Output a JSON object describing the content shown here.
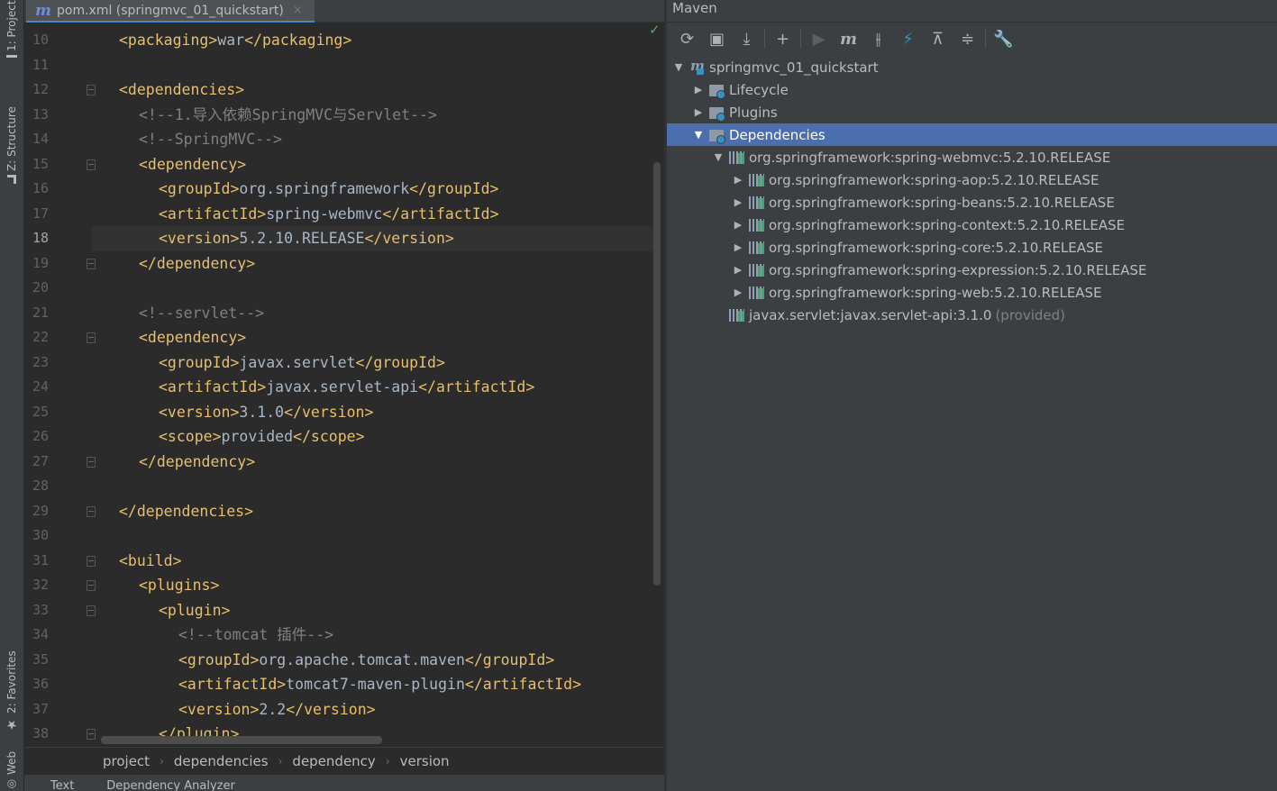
{
  "left_strip": {
    "project_tab": "1: Project",
    "structure_tab": "Z: Structure",
    "favorites_tab": "2: Favorites",
    "web_tab": "Web"
  },
  "editor": {
    "file_tab": {
      "icon": "maven-m-icon",
      "label": "pom.xml (springmvc_01_quickstart)",
      "close": "×"
    },
    "current_line": 18,
    "lines": [
      {
        "num": "10",
        "parts": [
          [
            "tag",
            "<packaging>"
          ],
          [
            "txt",
            "war"
          ],
          [
            "tag",
            "</packaging>"
          ]
        ],
        "indent": 0,
        "fold": false
      },
      {
        "num": "11",
        "parts": [],
        "indent": 0,
        "fold": false
      },
      {
        "num": "12",
        "parts": [
          [
            "tag",
            "<dependencies>"
          ]
        ],
        "indent": 0,
        "fold": true
      },
      {
        "num": "13",
        "parts": [
          [
            "cmt",
            "<!--1.导入依赖SpringMVC与Servlet-->"
          ]
        ],
        "indent": 1,
        "fold": false
      },
      {
        "num": "14",
        "parts": [
          [
            "cmt",
            "<!--SpringMVC-->"
          ]
        ],
        "indent": 1,
        "fold": false
      },
      {
        "num": "15",
        "parts": [
          [
            "tag",
            "<dependency>"
          ]
        ],
        "indent": 1,
        "fold": true
      },
      {
        "num": "16",
        "parts": [
          [
            "tag",
            "<groupId>"
          ],
          [
            "txt",
            "org.springframework"
          ],
          [
            "tag",
            "</groupId>"
          ]
        ],
        "indent": 2,
        "fold": false
      },
      {
        "num": "17",
        "parts": [
          [
            "tag",
            "<artifactId>"
          ],
          [
            "txt",
            "spring-webmvc"
          ],
          [
            "tag",
            "</artifactId>"
          ]
        ],
        "indent": 2,
        "fold": false
      },
      {
        "num": "18",
        "parts": [
          [
            "tag",
            "<version>"
          ],
          [
            "txt",
            "5.2.10.RELEASE"
          ],
          [
            "tag",
            "</version>"
          ]
        ],
        "indent": 2,
        "fold": false
      },
      {
        "num": "19",
        "parts": [
          [
            "tag",
            "</dependency>"
          ]
        ],
        "indent": 1,
        "fold": true
      },
      {
        "num": "20",
        "parts": [],
        "indent": 0,
        "fold": false
      },
      {
        "num": "21",
        "parts": [
          [
            "cmt",
            "<!--servlet-->"
          ]
        ],
        "indent": 1,
        "fold": false
      },
      {
        "num": "22",
        "parts": [
          [
            "tag",
            "<dependency>"
          ]
        ],
        "indent": 1,
        "fold": true
      },
      {
        "num": "23",
        "parts": [
          [
            "tag",
            "<groupId>"
          ],
          [
            "txt",
            "javax.servlet"
          ],
          [
            "tag",
            "</groupId>"
          ]
        ],
        "indent": 2,
        "fold": false
      },
      {
        "num": "24",
        "parts": [
          [
            "tag",
            "<artifactId>"
          ],
          [
            "txt",
            "javax.servlet-api"
          ],
          [
            "tag",
            "</artifactId>"
          ]
        ],
        "indent": 2,
        "fold": false
      },
      {
        "num": "25",
        "parts": [
          [
            "tag",
            "<version>"
          ],
          [
            "txt",
            "3.1.0"
          ],
          [
            "tag",
            "</version>"
          ]
        ],
        "indent": 2,
        "fold": false
      },
      {
        "num": "26",
        "parts": [
          [
            "tag",
            "<scope>"
          ],
          [
            "txt",
            "provided"
          ],
          [
            "tag",
            "</scope>"
          ]
        ],
        "indent": 2,
        "fold": false
      },
      {
        "num": "27",
        "parts": [
          [
            "tag",
            "</dependency>"
          ]
        ],
        "indent": 1,
        "fold": true
      },
      {
        "num": "28",
        "parts": [],
        "indent": 0,
        "fold": false
      },
      {
        "num": "29",
        "parts": [
          [
            "tag",
            "</dependencies>"
          ]
        ],
        "indent": 0,
        "fold": true
      },
      {
        "num": "30",
        "parts": [],
        "indent": 0,
        "fold": false
      },
      {
        "num": "31",
        "parts": [
          [
            "tag",
            "<build>"
          ]
        ],
        "indent": 0,
        "fold": true
      },
      {
        "num": "32",
        "parts": [
          [
            "tag",
            "<plugins>"
          ]
        ],
        "indent": 1,
        "fold": true
      },
      {
        "num": "33",
        "parts": [
          [
            "tag",
            "<plugin>"
          ]
        ],
        "indent": 2,
        "fold": true
      },
      {
        "num": "34",
        "parts": [
          [
            "cmt",
            "<!--tomcat 插件-->"
          ]
        ],
        "indent": 3,
        "fold": false
      },
      {
        "num": "35",
        "parts": [
          [
            "tag",
            "<groupId>"
          ],
          [
            "txt",
            "org.apache.tomcat.maven"
          ],
          [
            "tag",
            "</groupId>"
          ]
        ],
        "indent": 3,
        "fold": false
      },
      {
        "num": "36",
        "parts": [
          [
            "tag",
            "<artifactId>"
          ],
          [
            "txt",
            "tomcat7-maven-plugin"
          ],
          [
            "tag",
            "</artifactId>"
          ]
        ],
        "indent": 3,
        "fold": false
      },
      {
        "num": "37",
        "parts": [
          [
            "tag",
            "<version>"
          ],
          [
            "txt",
            "2.2"
          ],
          [
            "tag",
            "</version>"
          ]
        ],
        "indent": 3,
        "fold": false
      },
      {
        "num": "38",
        "parts": [
          [
            "tag",
            "</plugin>"
          ]
        ],
        "indent": 2,
        "fold": true
      }
    ],
    "breadcrumb": [
      "project",
      "dependencies",
      "dependency",
      "version"
    ],
    "bottom_tabs": [
      "Text",
      "Dependency Analyzer"
    ]
  },
  "maven": {
    "title": "Maven",
    "toolbar": [
      {
        "name": "reload-icon",
        "glyph": "⟳"
      },
      {
        "name": "generate-sources-icon",
        "glyph": "▣"
      },
      {
        "name": "download-icon",
        "glyph": "⤓"
      },
      {
        "sep": true
      },
      {
        "name": "add-icon",
        "glyph": "+"
      },
      {
        "sep": true
      },
      {
        "name": "run-icon",
        "glyph": "▶"
      },
      {
        "name": "execute-goal-icon",
        "glyph": "m"
      },
      {
        "name": "toggle-offline-icon",
        "glyph": "⫲"
      },
      {
        "name": "skip-tests-icon",
        "glyph": "⚡"
      },
      {
        "name": "show-dependencies-icon",
        "glyph": "⊼"
      },
      {
        "name": "collapse-all-icon",
        "glyph": "≑"
      },
      {
        "sep": true
      },
      {
        "name": "settings-wrench-icon",
        "glyph": "🔧"
      }
    ],
    "tree": [
      {
        "label": "springmvc_01_quickstart",
        "level": 0,
        "arrow": "▼",
        "icon": "proj",
        "selected": false
      },
      {
        "label": "Lifecycle",
        "level": 1,
        "arrow": "▶",
        "icon": "folder-gear",
        "selected": false
      },
      {
        "label": "Plugins",
        "level": 1,
        "arrow": "▶",
        "icon": "folder-gear",
        "selected": false
      },
      {
        "label": "Dependencies",
        "level": 1,
        "arrow": "▼",
        "icon": "folder-gear",
        "selected": true
      },
      {
        "label": "org.springframework:spring-webmvc:5.2.10.RELEASE",
        "level": 2,
        "arrow": "▼",
        "icon": "lib",
        "selected": false
      },
      {
        "label": "org.springframework:spring-aop:5.2.10.RELEASE",
        "level": 3,
        "arrow": "▶",
        "icon": "lib",
        "selected": false
      },
      {
        "label": "org.springframework:spring-beans:5.2.10.RELEASE",
        "level": 3,
        "arrow": "▶",
        "icon": "lib",
        "selected": false
      },
      {
        "label": "org.springframework:spring-context:5.2.10.RELEASE",
        "level": 3,
        "arrow": "▶",
        "icon": "lib",
        "selected": false
      },
      {
        "label": "org.springframework:spring-core:5.2.10.RELEASE",
        "level": 3,
        "arrow": "▶",
        "icon": "lib",
        "selected": false
      },
      {
        "label": "org.springframework:spring-expression:5.2.10.RELEASE",
        "level": 3,
        "arrow": "▶",
        "icon": "lib",
        "selected": false
      },
      {
        "label": "org.springframework:spring-web:5.2.10.RELEASE",
        "level": 3,
        "arrow": "▶",
        "icon": "lib",
        "selected": false
      },
      {
        "label": "javax.servlet:javax.servlet-api:3.1.0",
        "suffix": "(provided)",
        "level": 2,
        "arrow": "",
        "icon": "lib",
        "selected": false
      }
    ]
  },
  "colors": {
    "editor_bg": "#2b2b2b",
    "panel_bg": "#3c3f41",
    "tag": "#e8bf6a",
    "text": "#a9b7c6",
    "comment": "#808080",
    "selection": "#4b6eaf"
  }
}
